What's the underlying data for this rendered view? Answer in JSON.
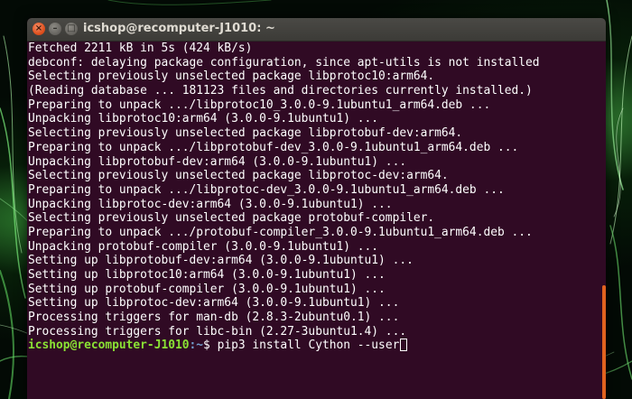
{
  "window": {
    "title": "icshop@recomputer-J1010: ~",
    "close_symbol": "×",
    "minimize_symbol": "–",
    "maximize_symbol": "□"
  },
  "terminal": {
    "lines": [
      "Fetched 2211 kB in 5s (424 kB/s)",
      "debconf: delaying package configuration, since apt-utils is not installed",
      "Selecting previously unselected package libprotoc10:arm64.",
      "(Reading database ... 181123 files and directories currently installed.)",
      "Preparing to unpack .../libprotoc10_3.0.0-9.1ubuntu1_arm64.deb ...",
      "Unpacking libprotoc10:arm64 (3.0.0-9.1ubuntu1) ...",
      "Selecting previously unselected package libprotobuf-dev:arm64.",
      "Preparing to unpack .../libprotobuf-dev_3.0.0-9.1ubuntu1_arm64.deb ...",
      "Unpacking libprotobuf-dev:arm64 (3.0.0-9.1ubuntu1) ...",
      "Selecting previously unselected package libprotoc-dev:arm64.",
      "Preparing to unpack .../libprotoc-dev_3.0.0-9.1ubuntu1_arm64.deb ...",
      "Unpacking libprotoc-dev:arm64 (3.0.0-9.1ubuntu1) ...",
      "Selecting previously unselected package protobuf-compiler.",
      "Preparing to unpack .../protobuf-compiler_3.0.0-9.1ubuntu1_arm64.deb ...",
      "Unpacking protobuf-compiler (3.0.0-9.1ubuntu1) ...",
      "Setting up libprotobuf-dev:arm64 (3.0.0-9.1ubuntu1) ...",
      "Setting up libprotoc10:arm64 (3.0.0-9.1ubuntu1) ...",
      "Setting up protobuf-compiler (3.0.0-9.1ubuntu1) ...",
      "Setting up libprotoc-dev:arm64 (3.0.0-9.1ubuntu1) ...",
      "Processing triggers for man-db (2.8.3-2ubuntu0.1) ...",
      "Processing triggers for libc-bin (2.27-3ubuntu1.4) ..."
    ],
    "prompt": {
      "user_host": "icshop@recomputer-J1010",
      "path": ":~",
      "symbol": "$ ",
      "command": "pip3 install Cython --user"
    }
  },
  "colors": {
    "terminal_bg": "#300a24",
    "prompt_user": "#8ae234",
    "prompt_path": "#729fcf",
    "scrollbar_thumb": "#e0621f"
  },
  "icons": {
    "close": "close-icon",
    "minimize": "minimize-icon",
    "maximize": "maximize-icon"
  }
}
